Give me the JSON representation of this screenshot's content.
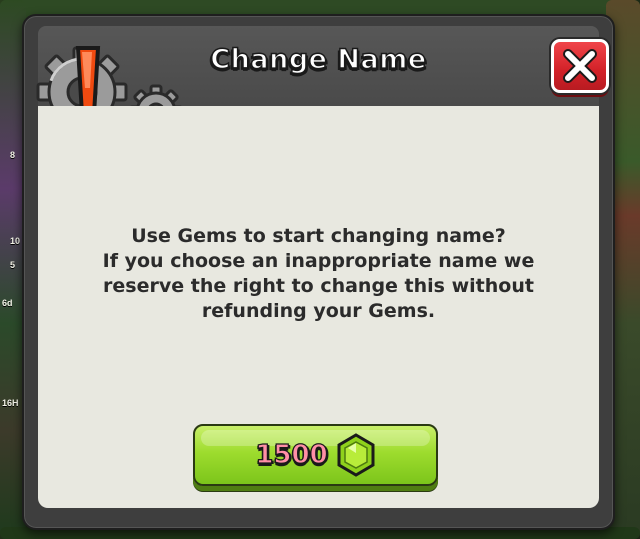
{
  "background": {
    "side_tags": [
      "8",
      "10",
      "5",
      "6d",
      "16H"
    ]
  },
  "dialog": {
    "title": "Change Name",
    "close_label": "X",
    "message_lines": [
      "Use Gems to start changing name?",
      "If you choose an inappropriate name we",
      "reserve the right to change this without",
      "refunding your Gems."
    ],
    "price": "1500",
    "currency_icon": "gem-icon",
    "header_icon": "gears-alert-icon"
  },
  "colors": {
    "close_red": "#d22128",
    "buy_green": "#9edc2e",
    "gem_green": "#8fd11c",
    "alert_orange": "#f04a10"
  }
}
